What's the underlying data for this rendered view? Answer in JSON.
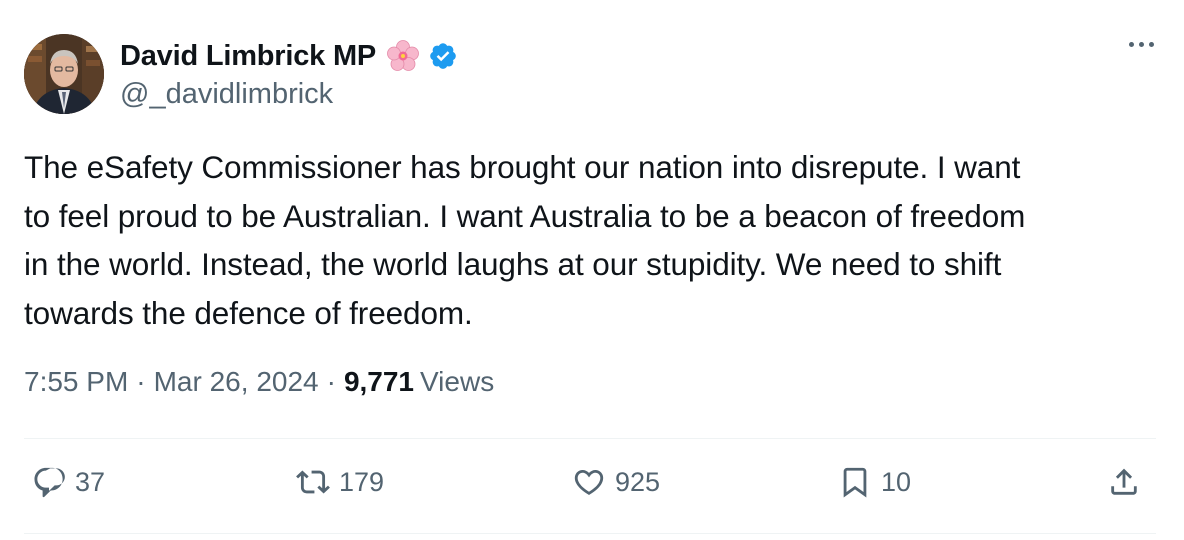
{
  "author": {
    "name": "David Limbrick MP",
    "handle": "@_davidlimbrick",
    "badge_emoji_icon": "cherry-blossom-icon",
    "verified_icon": "verified-badge-icon",
    "verified_color": "#1d9bf0"
  },
  "tweet": {
    "text": "The eSafety Commissioner has brought our nation into disrepute. I want\nto feel proud to be Australian. I want Australia to be a beacon of freedom\nin the world. Instead, the world laughs at our stupidity. We need to shift\ntowards the defence of freedom.",
    "time": "7:55 PM",
    "date": "Mar 26, 2024",
    "views_count": "9,771",
    "views_label": "Views"
  },
  "actions": {
    "replies": "37",
    "retweets": "179",
    "likes": "925",
    "bookmarks": "10"
  },
  "colors": {
    "text": "#0f1419",
    "secondary": "#536471",
    "divider": "#eff3f4"
  }
}
